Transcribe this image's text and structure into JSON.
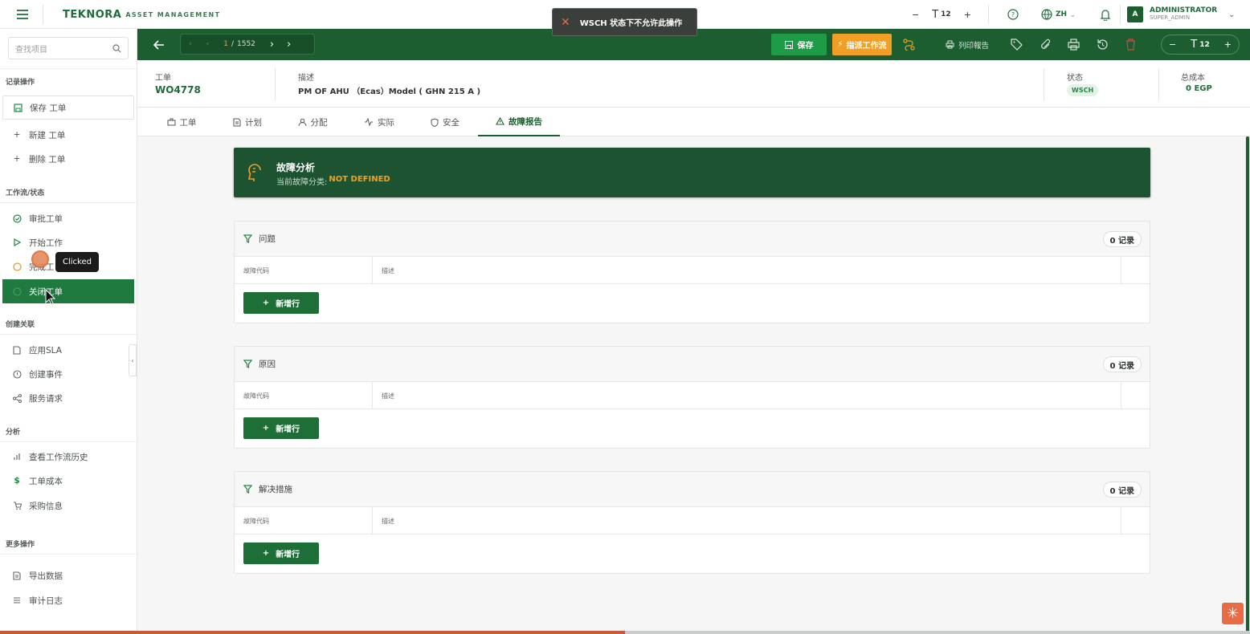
{
  "topbar": {
    "brand": "TEKNORA",
    "brand_sub": "ASSET MANAGEMENT",
    "font_size_value": "12",
    "lang": "ZH",
    "user_name": "ADMINISTRATOR",
    "user_role": "SUPER_ADMIN",
    "avatar_letter": "A"
  },
  "toast": {
    "message": "WSCH 状态下不允许此操作"
  },
  "sidebar": {
    "search_placeholder": "查找项目",
    "sections": {
      "record": "记录操作",
      "workflow": "工作流/状态",
      "create": "创建关联",
      "analysis": "分析",
      "more": "更多操作"
    },
    "items": {
      "save": "保存 工单",
      "new": "新建 工单",
      "delete": "删除 工单",
      "approve": "审批工单",
      "start": "开始工作",
      "complete": "完成工",
      "close": "关闭工单",
      "sla": "应用SLA",
      "incident": "创建事件",
      "service": "服务请求",
      "history": "查看工作流历史",
      "cost": "工单成本",
      "purchase": "采购信息",
      "export": "导出数据",
      "audit": "审计日志"
    },
    "tooltip": "Clicked"
  },
  "toolbar": {
    "page_current": "1",
    "page_sep": "/",
    "page_total": "1552",
    "save_label": "保存",
    "dispatch_label": "指派工作流",
    "print_report_label": "列印報告",
    "font_size_value": "12"
  },
  "header": {
    "wo_label": "工单",
    "wo_value": "WO4778",
    "desc_label": "描述",
    "desc_value": "PM OF AHU （Ecas）Model ( GHN 215 A )",
    "status_label": "状态",
    "status_value": "WSCH",
    "cost_label": "总成本",
    "cost_value": "0 EGP"
  },
  "tabs": [
    "工单",
    "计划",
    "分配",
    "实际",
    "安全",
    "故障报告"
  ],
  "banner": {
    "title": "故障分析",
    "subtitle_prefix": "当前故障分类:",
    "subtitle_value": "NOT DEFINED"
  },
  "cards": [
    {
      "title": "问题",
      "count": "0 记录",
      "col1": "故障代码",
      "col2": "描述",
      "add": "新增行"
    },
    {
      "title": "原因",
      "count": "0 记录",
      "col1": "故障代码",
      "col2": "描述",
      "add": "新增行"
    },
    {
      "title": "解决措施",
      "count": "0 记录",
      "col1": "故障代码",
      "col2": "描述",
      "add": "新增行"
    }
  ],
  "progress": {
    "fraction": 0.5
  },
  "colors": {
    "primary": "#1d5e31",
    "accent": "#f2a024",
    "active_nav": "#1f7a3f",
    "toast": "#3a3f3c"
  }
}
